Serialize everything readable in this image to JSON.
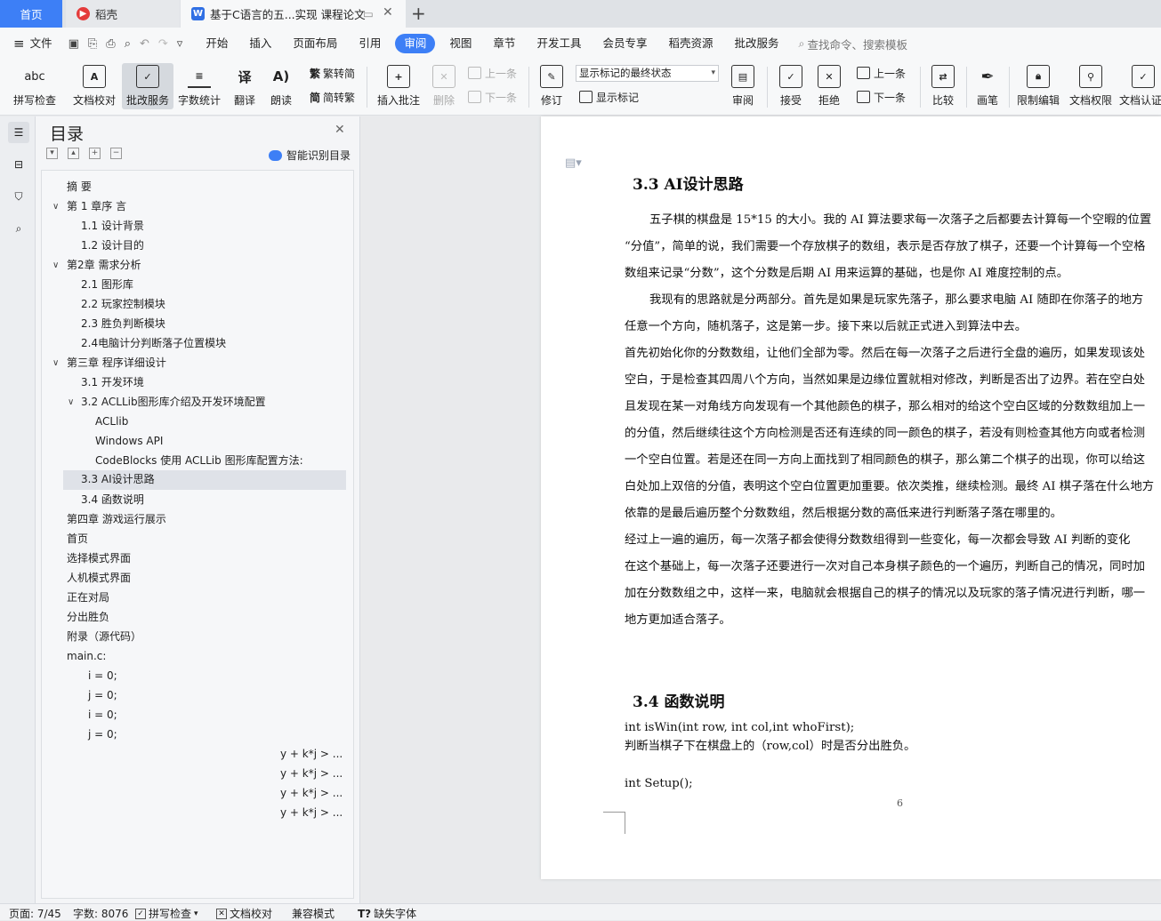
{
  "tabs": {
    "home": "首页",
    "daoke": "稻壳",
    "doc": "基于C语言的五...实现 课程论文"
  },
  "menu": [
    "文件",
    "开始",
    "插入",
    "页面布局",
    "引用",
    "审阅",
    "视图",
    "章节",
    "开发工具",
    "会员专享",
    "稻壳资源",
    "批改服务"
  ],
  "search": {
    "placeholder": "查找命令、搜索模板"
  },
  "ribbon": {
    "spell": "拼写检查",
    "proof": "文档校对",
    "grading": "批改服务",
    "wordcount": "字数统计",
    "translate": "翻译",
    "read": "朗读",
    "t2s": "繁转简",
    "s2t": "简转繁",
    "insert_comment": "插入批注",
    "delete": "删除",
    "prev": "上一条",
    "next": "下一条",
    "track": "修订",
    "markup_select": "显示标记的最终状态",
    "show_markup": "显示标记",
    "review": "审阅",
    "accept": "接受",
    "reject": "拒绝",
    "prev2": "上一条",
    "next2": "下一条",
    "compare": "比较",
    "pen": "画笔",
    "restrict": "限制编辑",
    "doc_rights": "文档权限",
    "doc_cert": "文档认证"
  },
  "nav": {
    "title": "目录",
    "smart": "智能识别目录"
  },
  "toc": [
    "摘  要",
    "第 1 章序  言",
    "1.1  设计背景",
    "1.2  设计目的",
    "第2章  需求分析",
    "2.1  图形库",
    "2.2  玩家控制模块",
    "2.3  胜负判断模块",
    "2.4电脑计分判断落子位置模块",
    "第三章  程序详细设计",
    "3.1  开发环境",
    "3.2 ACLLib图形库介绍及开发环境配置",
    "ACLlib",
    "Windows API",
    "CodeBlocks 使用 ACLLib 图形库配置方法:",
    "3.3 AI设计思路",
    "3.4  函数说明",
    "第四章  游戏运行展示",
    "首页",
    "选择模式界面",
    "人机模式界面",
    "正在对局",
    "分出胜负",
    "附录（源代码）",
    "main.c:",
    "i = 0;",
    "j = 0;",
    "i = 0;",
    "j = 0;",
    "y + k*j > ...",
    "y + k*j > ...",
    "y + k*j > ...",
    "y + k*j > ..."
  ],
  "doc": {
    "h33": "3.3 AI设计思路",
    "lines": [
      "五子棋的棋盘是 15*15 的大小。我的 AI 算法要求每一次落子之后都要去计算每一个空暇的位置",
      "“分值”，简单的说，我们需要一个存放棋子的数组，表示是否存放了棋子，还要一个计算每一个空格",
      "数组来记录“分数”，这个分数是后期 AI 用来运算的基础，也是你 AI 难度控制的点。",
      "我现有的思路就是分两部分。首先是如果是玩家先落子，那么要求电脑 AI 随即在你落子的地方",
      "任意一个方向，随机落子，这是第一步。接下来以后就正式进入到算法中去。",
      "首先初始化你的分数数组，让他们全部为零。然后在每一次落子之后进行全盘的遍历，如果发现该处",
      "空白，于是检查其四周八个方向，当然如果是边缘位置就相对修改，判断是否出了边界。若在空白处",
      "且发现在某一对角线方向发现有一个其他颜色的棋子，那么相对的给这个空白区域的分数数组加上一",
      "的分值，然后继续往这个方向检测是否还有连续的同一颜色的棋子，若没有则检查其他方向或者检测",
      "一个空白位置。若是还在同一方向上面找到了相同颜色的棋子，那么第二个棋子的出现，你可以给这",
      "白处加上双倍的分值，表明这个空白位置更加重要。依次类推，继续检测。最终 AI 棋子落在什么地方",
      "依靠的是最后遍历整个分数数组，然后根据分数的高低来进行判断落子落在哪里的。",
      " 经过上一遍的遍历，每一次落子都会使得分数数组得到一些变化，每一次都会导致 AI 判断的变化",
      "在这个基础上，每一次落子还要进行一次对自己本身棋子颜色的一个遍历，判断自己的情况，同时加",
      "加在分数数组之中，这样一来，电脑就会根据自己的棋子的情况以及玩家的落子情况进行判断，哪一",
      "地方更加适合落子。"
    ],
    "h34": "3.4  函数说明",
    "code1": "int isWin(int row, int col,int whoFirst);",
    "desc1": "判断当棋子下在棋盘上的（row,col）时是否分出胜负。",
    "code2": "int Setup();",
    "page_no": "6"
  },
  "status": {
    "page": "页面: 7/45",
    "words": "字数: 8076",
    "spell": "拼写检查",
    "proof": "文档校对",
    "compat": "兼容模式",
    "missing_font": "缺失字体"
  },
  "colors": {
    "accent": "#3d7ff6",
    "selected": "#dfe2e8"
  }
}
